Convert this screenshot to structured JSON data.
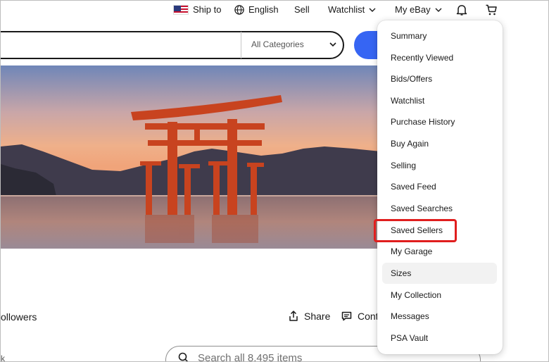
{
  "topnav": {
    "ship_to": "Ship to",
    "language": "English",
    "sell": "Sell",
    "watchlist": "Watchlist",
    "my_ebay": "My eBay"
  },
  "search": {
    "category": "All Categories"
  },
  "store": {
    "followers": "ollowers",
    "share": "Share",
    "contact": "Cont",
    "left_fragment": "k",
    "search_placeholder": "Search all 8,495 items"
  },
  "menu": {
    "items": [
      "Summary",
      "Recently Viewed",
      "Bids/Offers",
      "Watchlist",
      "Purchase History",
      "Buy Again",
      "Selling",
      "Saved Feed",
      "Saved Searches",
      "Saved Sellers",
      "My Garage",
      "Sizes",
      "My Collection",
      "Messages",
      "PSA Vault"
    ],
    "hovered": "Sizes",
    "highlighted": "Saved Sellers"
  },
  "colors": {
    "accent_blue": "#3665f3",
    "highlight_red": "#e01e1e",
    "torii_red": "#c8431f"
  },
  "icons": {
    "flag": "us-flag-icon",
    "language": "globe-icon",
    "notifications": "bell-icon",
    "cart": "cart-icon",
    "search": "search-icon",
    "share": "share-icon",
    "contact": "message-icon"
  }
}
